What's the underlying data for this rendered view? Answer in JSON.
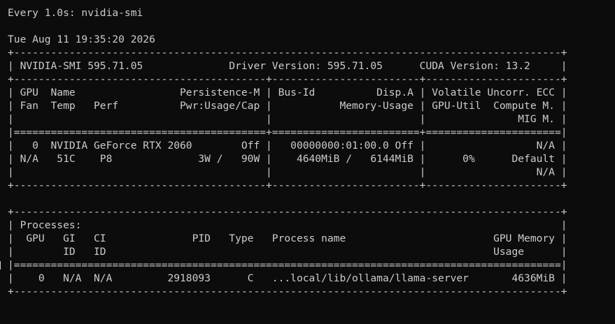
{
  "watch": {
    "header": "Every 1.0s: nvidia-smi",
    "timestamp": "Tue Aug 11 19:35:20 2026"
  },
  "smi_lines": [
    "+-----------------------------------------------------------------------------------------+",
    "| NVIDIA-SMI 595.71.05              Driver Version: 595.71.05      CUDA Version: 13.2     |",
    "+-----------------------------------------+------------------------+----------------------+",
    "| GPU  Name                 Persistence-M | Bus-Id          Disp.A | Volatile Uncorr. ECC |",
    "| Fan  Temp   Perf          Pwr:Usage/Cap |           Memory-Usage | GPU-Util  Compute M. |",
    "|                                         |                        |               MIG M. |",
    "|=========================================+========================+======================|",
    "|   0  NVIDIA GeForce RTX 2060        Off |   00000000:01:00.0 Off |                  N/A |",
    "| N/A   51C    P8              3W /   90W |    4640MiB /   6144MiB |      0%      Default |",
    "|                                         |                        |                  N/A |",
    "+-----------------------------------------+------------------------+----------------------+",
    "",
    "+-----------------------------------------------------------------------------------------+",
    "| Processes:                                                                              |",
    "|  GPU   GI   CI              PID   Type   Process name                        GPU Memory |",
    "|        ID   ID                                                               Usage      |",
    "|=========================================================================================|",
    "|    0   N/A  N/A         2918093      C   ...local/lib/ollama/llama-server       4636MiB |",
    "+-----------------------------------------------------------------------------------------+"
  ],
  "colors": {
    "background": "#0c0c0c",
    "foreground": "#cccccc"
  }
}
